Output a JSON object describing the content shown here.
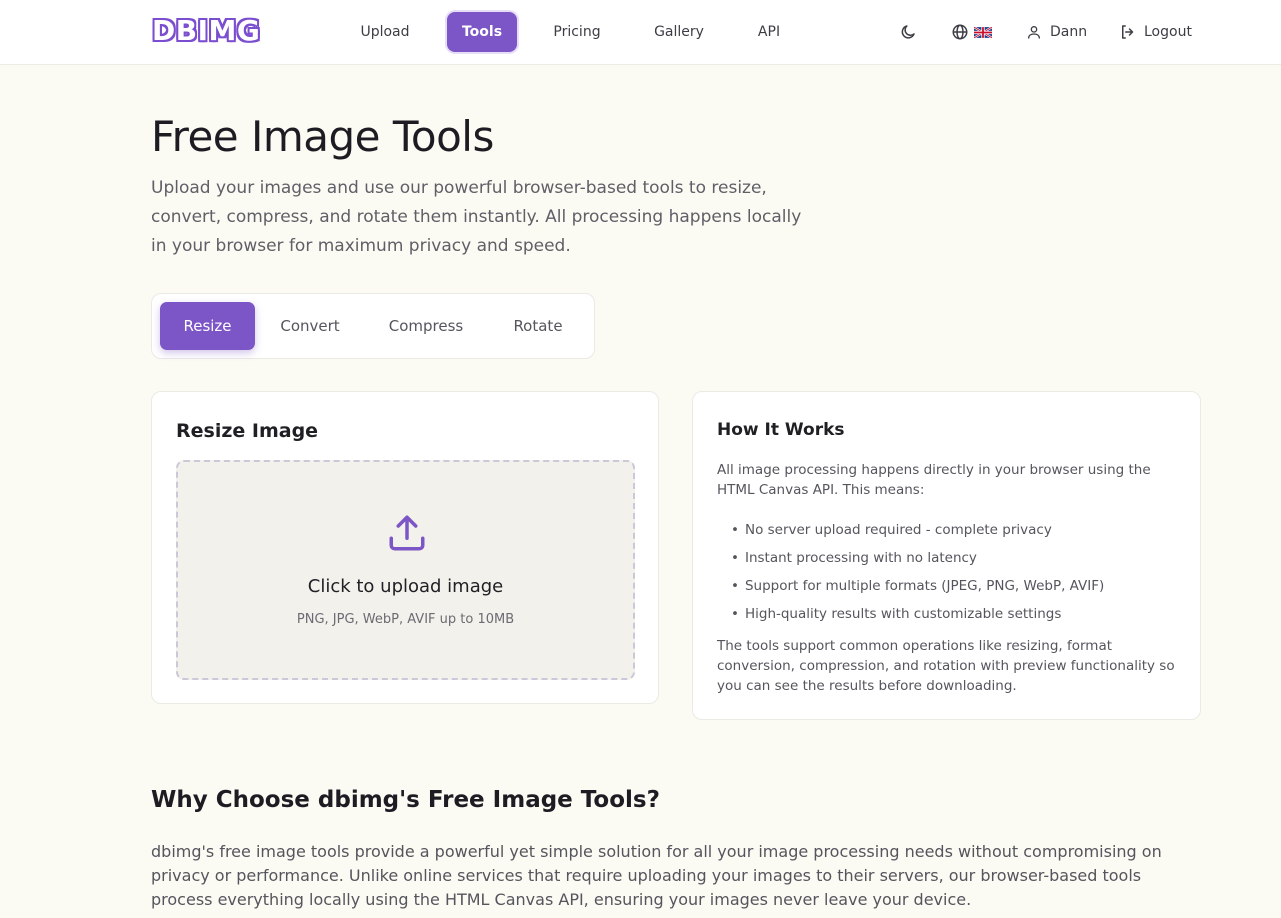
{
  "header": {
    "logo": "DBIMG",
    "nav": [
      {
        "label": "Upload"
      },
      {
        "label": "Tools"
      },
      {
        "label": "Pricing"
      },
      {
        "label": "Gallery"
      },
      {
        "label": "API"
      }
    ],
    "user_name": "Dann",
    "logout_label": "Logout"
  },
  "hero": {
    "title": "Free Image Tools",
    "subtitle": "Upload your images and use our powerful browser-based tools to resize, convert, compress, and rotate them instantly. All processing happens locally in your browser for maximum privacy and speed."
  },
  "tabs": [
    {
      "label": "Resize"
    },
    {
      "label": "Convert"
    },
    {
      "label": "Compress"
    },
    {
      "label": "Rotate"
    }
  ],
  "resize_card": {
    "title": "Resize Image",
    "upload_label": "Click to upload image",
    "upload_hint": "PNG, JPG, WebP, AVIF up to 10MB"
  },
  "how_card": {
    "title": "How It Works",
    "intro": "All image processing happens directly in your browser using the HTML Canvas API. This means:",
    "bullets": [
      "No server upload required - complete privacy",
      "Instant processing with no latency",
      "Support for multiple formats (JPEG, PNG, WebP, AVIF)",
      "High-quality results with customizable settings"
    ],
    "outro": "The tools support common operations like resizing, format conversion, compression, and rotation with preview functionality so you can see the results before downloading."
  },
  "why": {
    "title": "Why Choose dbimg's Free Image Tools?",
    "text": "dbimg's free image tools provide a powerful yet simple solution for all your image processing needs without compromising on privacy or performance. Unlike online services that require uploading your images to their servers, our browser-based tools process everything locally using the HTML Canvas API, ensuring your images never leave your device."
  },
  "colors": {
    "accent": "#7c55c6",
    "background": "#fbfaf3"
  }
}
